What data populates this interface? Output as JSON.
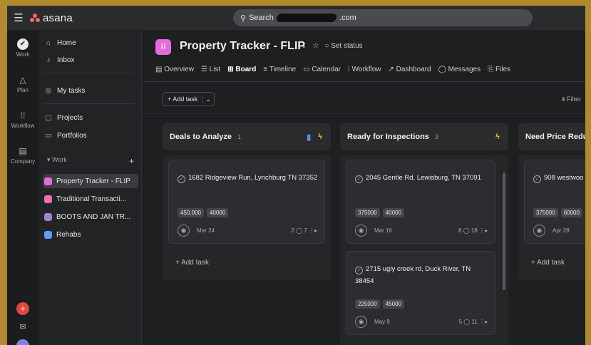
{
  "app": {
    "logo_text": "asana",
    "brand_color": "#f06a6a"
  },
  "search": {
    "prefix": "Search",
    "suffix": ".com"
  },
  "rail": {
    "items": [
      {
        "label": "Work",
        "icon": "check-circle-icon"
      },
      {
        "label": "Plan",
        "icon": "triangle-icon"
      },
      {
        "label": "Workflow",
        "icon": "workflow-icon"
      },
      {
        "label": "Company",
        "icon": "building-icon"
      }
    ]
  },
  "sidebar": {
    "home": "Home",
    "inbox": "Inbox",
    "my_tasks": "My tasks",
    "projects": "Projects",
    "portfolios": "Portfolios",
    "work_header": "Work",
    "work_add": "+",
    "projects_list": [
      {
        "label": "Property Tracker - FLIP",
        "color": "#e16ddb"
      },
      {
        "label": "Traditional Transacti...",
        "color": "#ef6fb5"
      },
      {
        "label": "BOOTS AND JAN TR...",
        "color": "#9d7fe0"
      },
      {
        "label": "Rehabs",
        "color": "#5aa2f0"
      }
    ]
  },
  "project": {
    "title": "Property Tracker - FLIP",
    "set_status": "Set status",
    "tabs": [
      "Overview",
      "List",
      "Board",
      "Timeline",
      "Calendar",
      "Workflow",
      "Dashboard",
      "Messages",
      "Files"
    ],
    "active_tab": "Board",
    "add_task": "+ Add task",
    "filter": "Filter"
  },
  "columns": [
    {
      "name": "Deals to Analyze",
      "count": "1",
      "cards": [
        {
          "title": "1682 Ridgeview Run, Lynchburg TN 37352",
          "chips": [
            "450,000",
            "40000"
          ],
          "date": "Mar 24",
          "comments": "2",
          "subtasks": "7"
        }
      ],
      "add_task": "+ Add task"
    },
    {
      "name": "Ready for Inspections",
      "count": "3",
      "cards": [
        {
          "title": "2045 Gentle Rd, Lewisburg, TN 37091",
          "chips": [
            "375000",
            "40000"
          ],
          "date": "Mar 16",
          "comments": "8",
          "subtasks": "18"
        },
        {
          "title": "2715 ugly creek rd, Duck River, TN 38454",
          "chips": [
            "225000",
            "45000"
          ],
          "date": "May 9",
          "comments": "5",
          "subtasks": "11"
        }
      ]
    },
    {
      "name": "Need Price Redu",
      "cards": [
        {
          "title": "908 westwoo 37388",
          "chips": [
            "375000",
            "60000"
          ],
          "date": "Apr 28"
        }
      ],
      "add_task": "+ Add task"
    }
  ]
}
